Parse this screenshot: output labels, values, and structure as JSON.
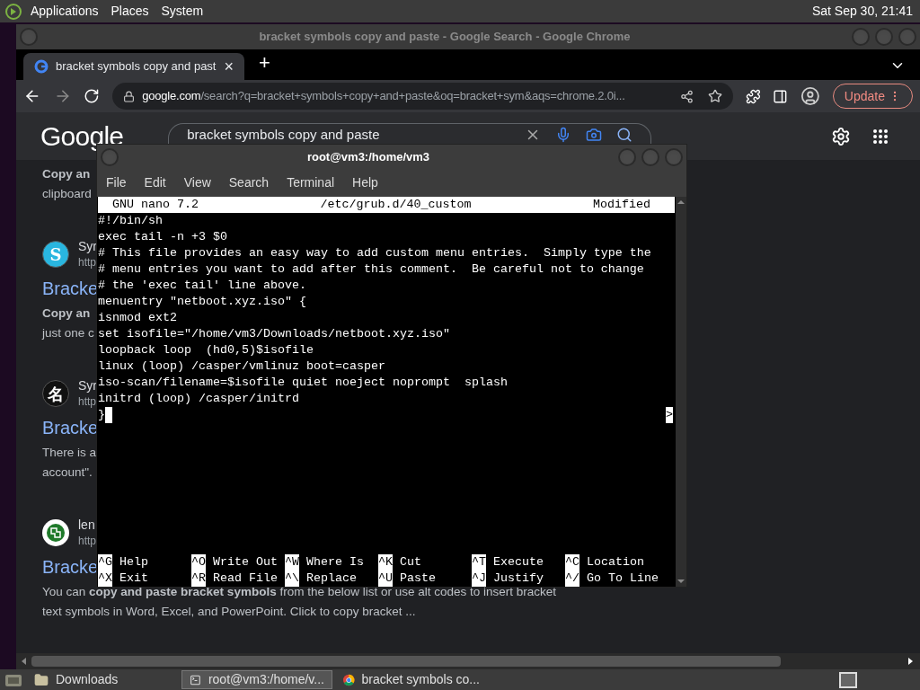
{
  "top_panel": {
    "menus": [
      "Applications",
      "Places",
      "System"
    ],
    "clock": "Sat Sep 30, 21:41"
  },
  "browser": {
    "title": "bracket symbols copy and paste - Google Search - Google Chrome",
    "tabs": [
      {
        "label": "bracket symbols copy and past",
        "close": "×",
        "selected": true
      }
    ],
    "new_tab": "+",
    "url": {
      "domain": "google.com",
      "path": "/search?q=bracket+symbols+copy+and+paste&oq=bracket+sym&aqs=chrome.2.0i..."
    },
    "update_button": "Update",
    "logo": "Google",
    "search_value": "bracket symbols copy and paste",
    "results": [
      {
        "lines": [
          {
            "text": "Copy an",
            "bold": true
          },
          {
            "text": "clipboard",
            "bold": false
          }
        ]
      },
      {
        "favicon": {
          "kind": "glyph",
          "glyph": "S",
          "color": "#29b6e0"
        },
        "site": "Syr",
        "url": "http",
        "title": "Bracke",
        "lines": [
          {
            "text": "Copy an",
            "bold": true
          },
          {
            "text": "just one c",
            "bold": false
          }
        ]
      },
      {
        "favicon": {
          "kind": "glyph",
          "glyph": "名",
          "color": "#111111"
        },
        "site": "Syr",
        "url": "http",
        "title": "Bracke",
        "lines": [
          {
            "text": "There is a",
            "bold": false
          },
          {
            "text": "account\".",
            "bold": false
          }
        ]
      },
      {
        "favicon": {
          "kind": "emblem",
          "color": "#1f7a2a"
        },
        "site": "len",
        "url": "http",
        "title": "Bracke",
        "lines": [
          {
            "text": "You can **copy and paste bracket symbols** from the below list or use alt codes to insert bracket",
            "bold": false
          },
          {
            "text": "text symbols in Word, Excel, and PowerPoint. Click to copy bracket ...",
            "bold": false
          }
        ]
      }
    ]
  },
  "terminal": {
    "title": "root@vm3:/home/vm3",
    "menus": [
      "File",
      "Edit",
      "View",
      "Search",
      "Terminal",
      "Help"
    ],
    "nano_header": {
      "version": "GNU nano 7.2",
      "file": "/etc/grub.d/40_custom",
      "status": "Modified"
    },
    "lines": [
      "#!/bin/sh",
      "exec tail -n +3 $0",
      "# This file provides an easy way to add custom menu entries.  Simply type the",
      "# menu entries you want to add after this comment.  Be careful not to change",
      "# the 'exec tail' line above.",
      "menuentry \"netboot.xyz.iso\" {",
      "isnmod ext2",
      "set isofile=\"/home/vm3/Downloads/netboot.xyz.iso\"",
      "loopback loop  (hd0,5)$isofile",
      "linux (loop) /casper/vmlinuz boot=casper",
      "iso-scan/filename=$isofile quiet noeject noprompt  splash",
      "initrd (loop) /casper/initrd"
    ],
    "current_line": {
      "text": "}",
      "more_marker": ">"
    },
    "shortcuts": [
      [
        {
          "key": "^G",
          "label": "Help"
        },
        {
          "key": "^O",
          "label": "Write Out"
        },
        {
          "key": "^W",
          "label": "Where Is"
        },
        {
          "key": "^K",
          "label": "Cut"
        },
        {
          "key": "^T",
          "label": "Execute"
        },
        {
          "key": "^C",
          "label": "Location"
        }
      ],
      [
        {
          "key": "^X",
          "label": "Exit"
        },
        {
          "key": "^R",
          "label": "Read File"
        },
        {
          "key": "^\\",
          "label": "Replace"
        },
        {
          "key": "^U",
          "label": "Paste"
        },
        {
          "key": "^J",
          "label": "Justify"
        },
        {
          "key": "^/",
          "label": "Go To Line"
        }
      ]
    ]
  },
  "taskbar": {
    "items": [
      {
        "label": "Downloads",
        "kind": "folder",
        "selected": false
      },
      {
        "label": "root@vm3:/home/v...",
        "kind": "terminal",
        "selected": true
      },
      {
        "label": "bracket symbols co...",
        "kind": "browser",
        "selected": false
      }
    ]
  }
}
